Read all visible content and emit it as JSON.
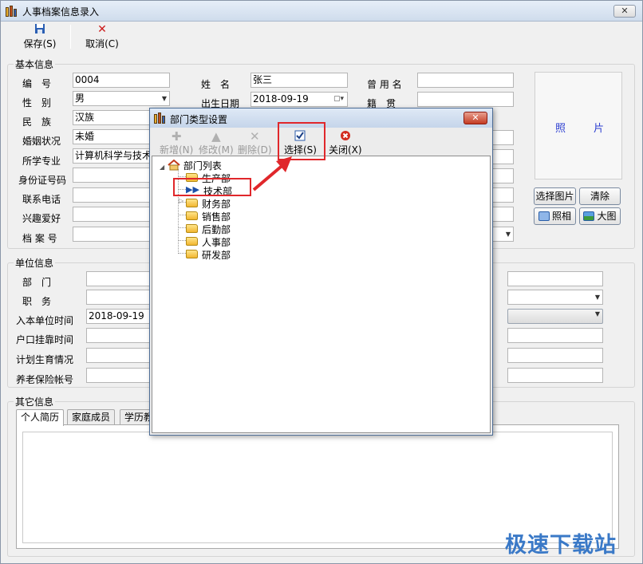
{
  "window": {
    "title": "人事档案信息录入",
    "close_label": "✕"
  },
  "toolbar": {
    "save_label": "保存(S)",
    "cancel_label": "取消(C)"
  },
  "basic": {
    "title": "基本信息",
    "fields": {
      "id": {
        "label": "编　号",
        "value": "0004"
      },
      "gender": {
        "label": "性　别",
        "value": "男"
      },
      "ethnic": {
        "label": "民　族",
        "value": "汉族"
      },
      "marital": {
        "label": "婚姻状况",
        "value": "未婚"
      },
      "major": {
        "label": "所学专业",
        "value": "计算机科学与技术"
      },
      "idcard": {
        "label": "身份证号码",
        "value": ""
      },
      "phone": {
        "label": "联系电话",
        "value": ""
      },
      "hobby": {
        "label": "兴趣爱好",
        "value": ""
      },
      "archive": {
        "label": "档 案 号",
        "value": ""
      },
      "name": {
        "label": "姓　名",
        "value": "张三"
      },
      "birth": {
        "label": "出生日期",
        "value": "2018-09-19"
      },
      "former_name": {
        "label": "曾 用 名",
        "value": ""
      },
      "native": {
        "label": "籍　贯",
        "value": ""
      }
    },
    "photo": {
      "label_left": "照",
      "label_right": "片"
    },
    "photo_buttons": {
      "select": "选择图片",
      "clear": "清除",
      "camera": "照相",
      "large": "大图"
    }
  },
  "unit": {
    "title": "单位信息",
    "fields": {
      "dept": {
        "label": "部　门"
      },
      "position": {
        "label": "职　务"
      },
      "join_date": {
        "label": "入本单位时间",
        "value": "2018-09-19"
      },
      "hukou": {
        "label": "户口挂靠时间"
      },
      "family_plan": {
        "label": "计划生育情况"
      },
      "pension": {
        "label": "养老保险帐号"
      }
    }
  },
  "other": {
    "title": "其它信息",
    "tabs": [
      "个人简历",
      "家庭成员",
      "学历教"
    ]
  },
  "dialog": {
    "title": "部门类型设置",
    "close_label": "✕",
    "toolbar": {
      "add": "新增(N)",
      "edit": "修改(M)",
      "delete": "删除(D)",
      "select": "选择(S)",
      "close": "关闭(X)"
    },
    "tree": {
      "root": "部门列表",
      "items": [
        "生产部",
        "技术部",
        "财务部",
        "销售部",
        "后勤部",
        "人事部",
        "研发部"
      ],
      "selected": "技术部"
    }
  },
  "watermark": "极速下载站",
  "colors": {
    "highlight": "#e0272b",
    "accent": "#3a79c7"
  }
}
